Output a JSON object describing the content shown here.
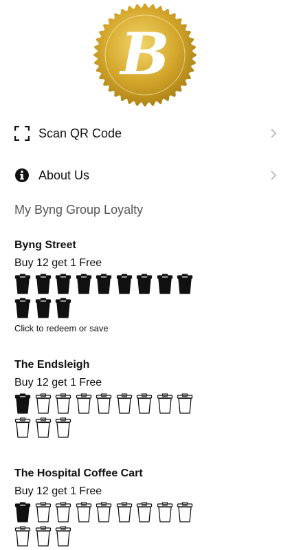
{
  "logo": {
    "letter": "B",
    "colors": {
      "gold": "#d4a72c",
      "gold_dark": "#a67c12",
      "gold_light": "#f3d66b"
    }
  },
  "menu": [
    {
      "label": "Scan QR Code",
      "icon": "qr-scan-icon"
    },
    {
      "label": "About Us",
      "icon": "info-icon"
    }
  ],
  "loyalty_section": {
    "title": "My Byng Group Loyalty"
  },
  "cards": [
    {
      "name": "Byng Street",
      "offer": "Buy 12 get 1 Free",
      "stamps_filled": 12,
      "stamps_total": 12,
      "note": "Click to redeem or save"
    },
    {
      "name": "The Endsleigh",
      "offer": "Buy 12 get 1 Free",
      "stamps_filled": 1,
      "stamps_total": 12,
      "note": ""
    },
    {
      "name": "The Hospital Coffee Cart",
      "offer": "Buy 12 get 1 Free",
      "stamps_filled": 1,
      "stamps_total": 12,
      "note": ""
    }
  ],
  "colors": {
    "text": "#111111",
    "muted": "#555555",
    "chevron": "#b8b8bd"
  }
}
